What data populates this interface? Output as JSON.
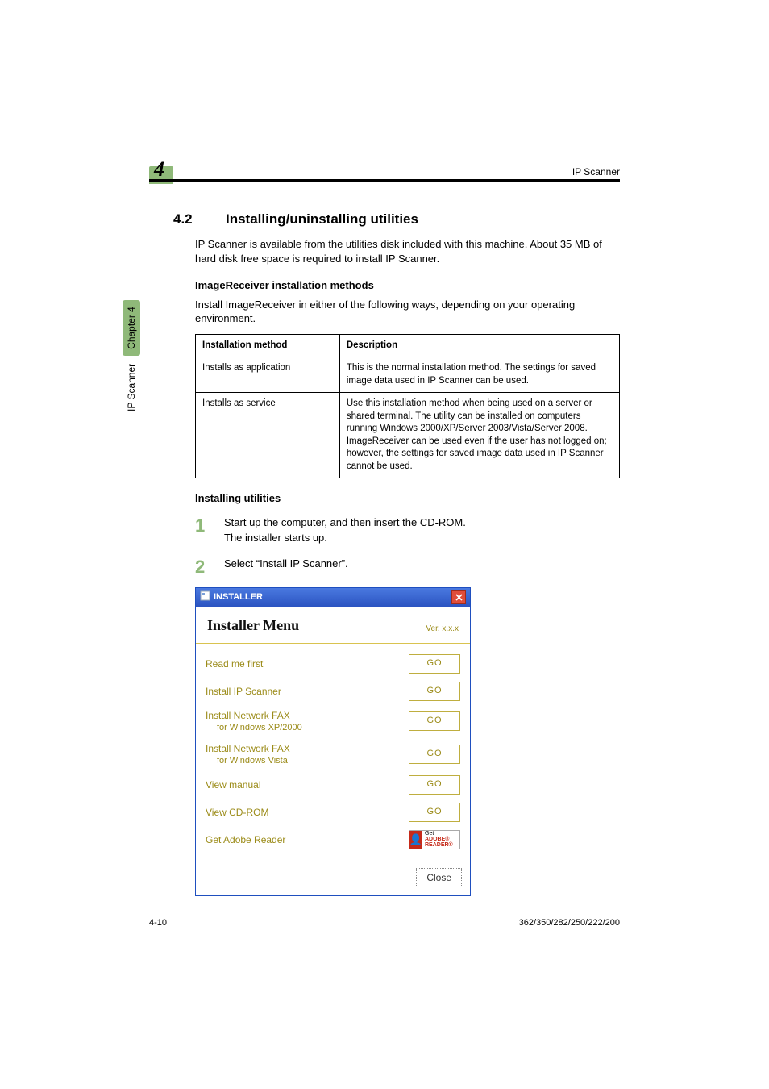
{
  "header": {
    "chapter_number": "4",
    "running_title": "IP Scanner"
  },
  "sidetab": {
    "label": "IP Scanner",
    "chapter": "Chapter 4"
  },
  "section": {
    "number": "4.2",
    "title": "Installing/uninstalling utilities",
    "intro": "IP Scanner is available from the utilities disk included with this machine. About 35 MB of hard disk free space is required to install IP Scanner."
  },
  "subsec1": {
    "heading": "ImageReceiver installation methods",
    "desc": "Install ImageReceiver in either of the following ways, depending on your operating environment."
  },
  "table": {
    "headers": [
      "Installation method",
      "Description"
    ],
    "rows": [
      {
        "method": "Installs as application",
        "desc": "This is the normal installation method. The settings for saved image data used in IP Scanner can be used."
      },
      {
        "method": "Installs as service",
        "desc": "Use this installation method when being used on a server or shared terminal. The utility can be installed on computers running Windows 2000/XP/Server 2003/Vista/Server 2008.\nImageReceiver can be used even if the user has not logged on; however, the settings for saved image data used in IP Scanner cannot be used."
      }
    ]
  },
  "subsec2": {
    "heading": "Installing utilities"
  },
  "steps": [
    {
      "num": "1",
      "text": "Start up the computer, and then insert the CD-ROM.",
      "text2": "The installer starts up."
    },
    {
      "num": "2",
      "text": "Select “Install IP Scanner”."
    }
  ],
  "installer": {
    "win_title": "INSTALLER",
    "title": "Installer Menu",
    "version": "Ver. x.x.x",
    "go_label": "GO",
    "items": [
      {
        "label": "Read me first"
      },
      {
        "label": "Install IP Scanner"
      },
      {
        "label": "Install Network FAX",
        "sub": "for Windows XP/2000"
      },
      {
        "label": "Install Network FAX",
        "sub": "for Windows Vista"
      },
      {
        "label": "View manual"
      },
      {
        "label": "View CD-ROM"
      }
    ],
    "adobe_label": "Get Adobe Reader",
    "adobe_get": "Get",
    "adobe_reader": "ADOBE® READER®",
    "close": "Close"
  },
  "footer": {
    "page": "4-10",
    "model": "362/350/282/250/222/200"
  }
}
